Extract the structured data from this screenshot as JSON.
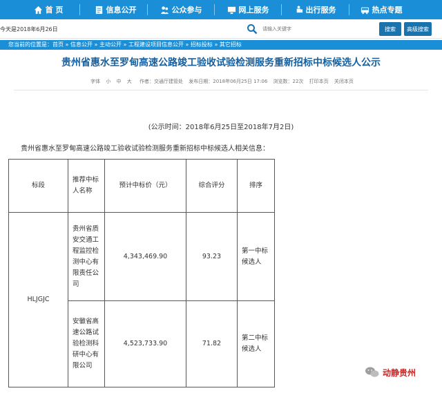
{
  "nav": [
    {
      "label": "首  页",
      "icon": "home-icon"
    },
    {
      "label": "信息公开",
      "icon": "document-icon"
    },
    {
      "label": "公众参与",
      "icon": "people-icon"
    },
    {
      "label": "网上服务",
      "icon": "monitor-icon"
    },
    {
      "label": "出行服务",
      "icon": "traveler-icon"
    },
    {
      "label": "热点专题",
      "icon": "bus-icon"
    }
  ],
  "date_text": "今天是2018年6月26日",
  "search": {
    "placeholder": "请输入关键字",
    "button": "搜索",
    "advanced_button": "高级搜索"
  },
  "breadcrumb": "您当前的位置是：首页 » 信息公开 » 主动公开 » 工程建设项目信息公开 » 招标投标 » 其它招标",
  "article": {
    "title": "贵州省惠水至罗甸高速公路竣工验收试验检测服务重新招标中标候选人公示",
    "font_label": "字体",
    "font_sizes": [
      "小",
      "中",
      "大"
    ],
    "author": "作者：交通厅建管处",
    "publish_date": "发布日期：2018年06月25日 17:06",
    "views": "浏览数：22次",
    "print": "打印本页",
    "close": "关闭本页",
    "notice_period": "(公示时间：2018年6月25日至2018年7月2日)",
    "intro": "贵州省惠水至罗甸高速公路竣工验收试验检测服务重新招标中标候选人相关信息："
  },
  "table": {
    "headers": [
      "标段",
      "推荐中标人名称",
      "预计中标价（元）",
      "综合评分",
      "排序"
    ],
    "section": "HLJGJC",
    "rows": [
      {
        "name": "贵州省质安交通工程监控检测中心有限责任公司",
        "price": "4,343,469.90",
        "score": "93.23",
        "rank": "第一中标候选人"
      },
      {
        "name": "安徽省高速公路试验检测科研中心有限公司",
        "price": "4,523,733.90",
        "score": "71.82",
        "rank": "第二中标候选人"
      }
    ]
  },
  "watermark": "动静贵州",
  "colors": {
    "nav_bg": "#1a8fd8",
    "title": "#1560a0",
    "button": "#1a73ac",
    "watermark": "#c62828"
  }
}
